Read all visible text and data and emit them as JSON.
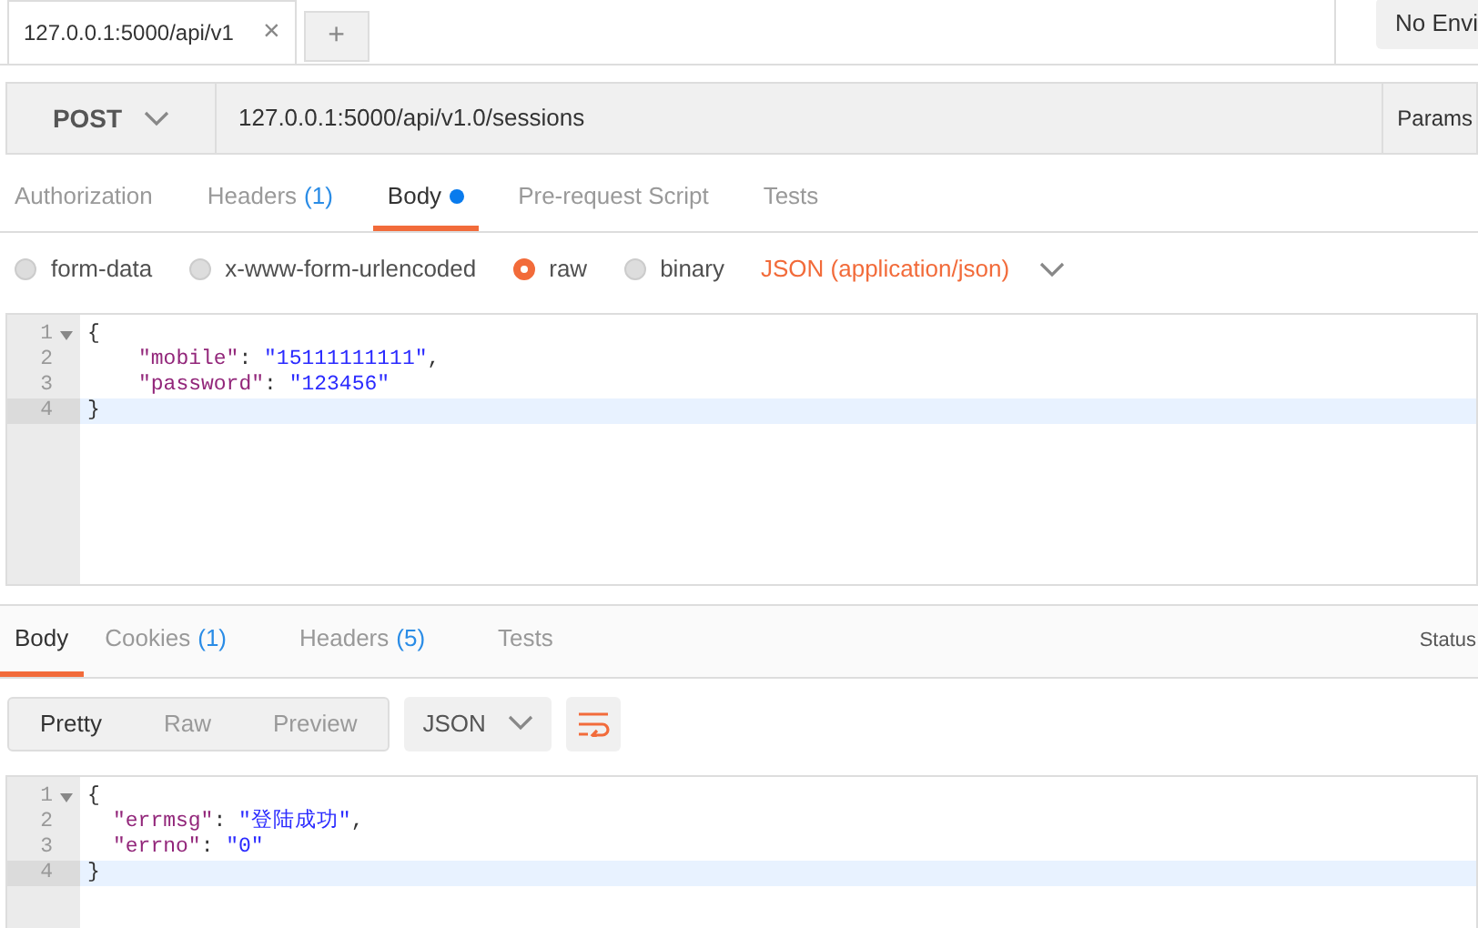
{
  "tabs": [
    {
      "label": "127.0.0.1:5000/api/v1",
      "selected": true,
      "close": "×"
    }
  ],
  "new_tab": "+",
  "environment": "No Envi",
  "request": {
    "method": "POST",
    "url": "127.0.0.1:5000/api/v1.0/sessions",
    "params": "Params"
  },
  "request_tabs": [
    {
      "label": "Authorization",
      "selected": false,
      "dot": false
    },
    {
      "label": "Headers",
      "count": "(1)",
      "selected": false,
      "dot": false
    },
    {
      "label": "Body",
      "selected": true,
      "dot": true
    },
    {
      "label": "Pre-request Script",
      "selected": false,
      "dot": false
    },
    {
      "label": "Tests",
      "selected": false,
      "dot": false
    }
  ],
  "body_modes": [
    {
      "label": "form-data",
      "selected": false
    },
    {
      "label": "x-www-form-urlencoded",
      "selected": false
    },
    {
      "label": "raw",
      "selected": true
    },
    {
      "label": "binary",
      "selected": false
    }
  ],
  "content_type": "JSON (application/json)",
  "request_body": [
    {
      "number": "1",
      "fold": true,
      "indented": false,
      "active": false,
      "tokens": [
        {
          "kind": "punct",
          "text": "{"
        }
      ]
    },
    {
      "number": "2",
      "fold": false,
      "indented": true,
      "active": false,
      "tokens": [
        {
          "kind": "key",
          "text": "\"mobile\""
        },
        {
          "kind": "punct",
          "text": ": "
        },
        {
          "kind": "string",
          "text": "\"15111111111\""
        },
        {
          "kind": "punct",
          "text": ","
        }
      ]
    },
    {
      "number": "3",
      "fold": false,
      "indented": true,
      "active": false,
      "tokens": [
        {
          "kind": "key",
          "text": "\"password\""
        },
        {
          "kind": "punct",
          "text": ": "
        },
        {
          "kind": "string",
          "text": "\"123456\""
        }
      ]
    },
    {
      "number": "4",
      "fold": false,
      "indented": false,
      "active": true,
      "tokens": [
        {
          "kind": "punct",
          "text": "}"
        }
      ]
    }
  ],
  "response_tabs": [
    {
      "label": "Body",
      "selected": true
    },
    {
      "label": "Cookies",
      "count": "(1)",
      "selected": false
    },
    {
      "label": "Headers",
      "count": "(5)",
      "selected": false
    },
    {
      "label": "Tests",
      "selected": false
    }
  ],
  "status": "Status",
  "view_modes": [
    {
      "label": "Pretty",
      "selected": true
    },
    {
      "label": "Raw",
      "selected": false
    },
    {
      "label": "Preview",
      "selected": false
    }
  ],
  "format": "JSON",
  "response_body": [
    {
      "number": "1",
      "fold": true,
      "indented": false,
      "active": false,
      "tokens": [
        {
          "kind": "punct",
          "text": "{"
        }
      ]
    },
    {
      "number": "2",
      "fold": false,
      "indented": true,
      "active": false,
      "tokens": [
        {
          "kind": "key",
          "text": "\"errmsg\""
        },
        {
          "kind": "punct",
          "text": ": "
        },
        {
          "kind": "string",
          "text": "\"登陆成功\""
        },
        {
          "kind": "punct",
          "text": ","
        }
      ]
    },
    {
      "number": "3",
      "fold": false,
      "indented": true,
      "active": false,
      "tokens": [
        {
          "kind": "key",
          "text": "\"errno\""
        },
        {
          "kind": "punct",
          "text": ": "
        },
        {
          "kind": "string",
          "text": "\"0\""
        }
      ]
    },
    {
      "number": "4",
      "fold": false,
      "indented": false,
      "active": true,
      "tokens": [
        {
          "kind": "punct",
          "text": "}"
        }
      ]
    }
  ]
}
